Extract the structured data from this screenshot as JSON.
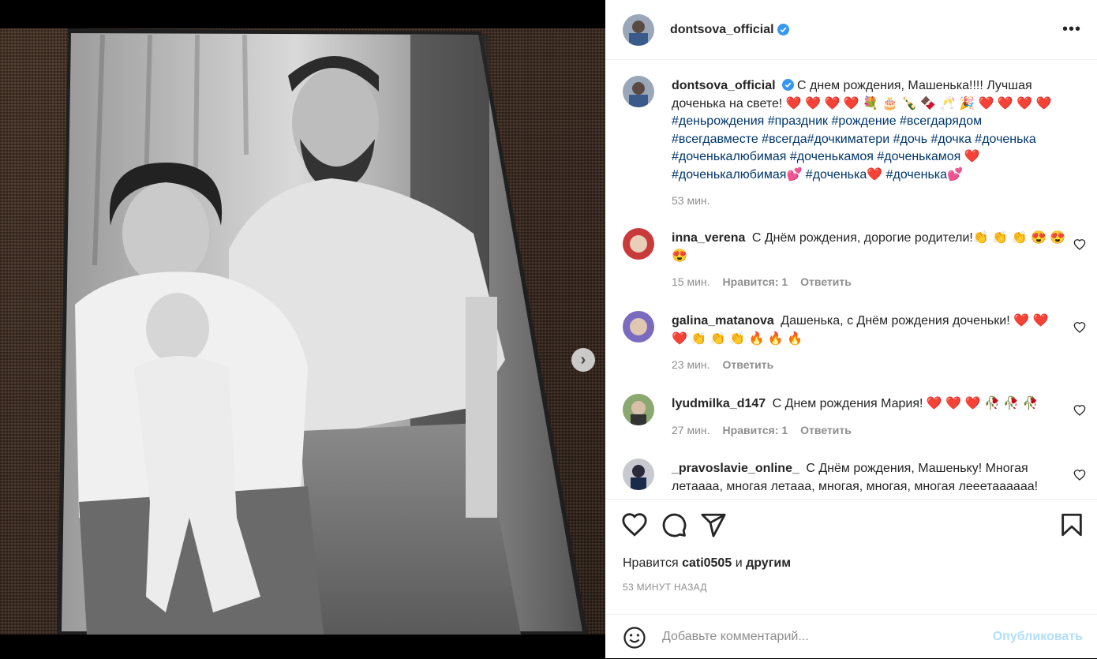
{
  "post": {
    "author": "dontsova_official",
    "caption_text": "С днем рождения, Машенька!!!! Лучшая доченька на свете! ❤️ ❤️ ❤️ ❤️ 💐 🎂 🍾 🍫 🥂 🎉 ❤️ ❤️ ❤️ ❤️",
    "hashtags": "#деньрождения #праздник #рождение #всегдарядом #всегдавместе #всегда#дочкиматери #дочь #дочка #доченька #доченькалюбимая #доченькамоя #доченькамоя ❤️ #доченькалюбимая💕 #доченька❤️ #доченька💕",
    "caption_time": "53 мин.",
    "likes_prefix": "Нравится",
    "likes_user": "cati0505",
    "likes_and": "и",
    "likes_others": "другим",
    "posted_ago": "53 МИНУТ НАЗАД"
  },
  "comments": [
    {
      "user": "inna_verena",
      "text": "С Днём рождения, дорогие родители!👏 👏 👏 😍 😍 😍",
      "time": "15 мин.",
      "likes": "Нравится: 1",
      "reply": "Ответить"
    },
    {
      "user": "galina_matanova",
      "text": "Дашенька, с Днём рождения доченьки! ❤️ ❤️ ❤️ 👏 👏 👏 🔥 🔥 🔥",
      "time": "23 мин.",
      "likes": "",
      "reply": "Ответить"
    },
    {
      "user": "lyudmilka_d147",
      "text": "С Днем рождения Мария! ❤️ ❤️ ❤️ 🥀 🥀 🥀",
      "time": "27 мин.",
      "likes": "Нравится: 1",
      "reply": "Ответить"
    },
    {
      "user": "_pravoslavie_online_",
      "text": "С Днём рождения, Машеньку! Многая летаааа, многая летааа, многая, многая, многая лееетаааааа!",
      "time": "",
      "likes": "",
      "reply": ""
    }
  ],
  "comment_box": {
    "placeholder": "Добавьте комментарий...",
    "publish": "Опубликовать"
  },
  "icons": {
    "more": "more-options-icon",
    "like": "heart-icon",
    "comment": "comment-icon",
    "share": "paper-plane-icon",
    "save": "bookmark-icon",
    "emoji": "emoji-icon",
    "next": "chevron-right-icon",
    "verified": "verified-badge-icon"
  },
  "colors": {
    "link": "#00376b",
    "verified": "#3897f0",
    "publish_disabled": "#b2dffc",
    "muted": "#8e8e8e"
  }
}
